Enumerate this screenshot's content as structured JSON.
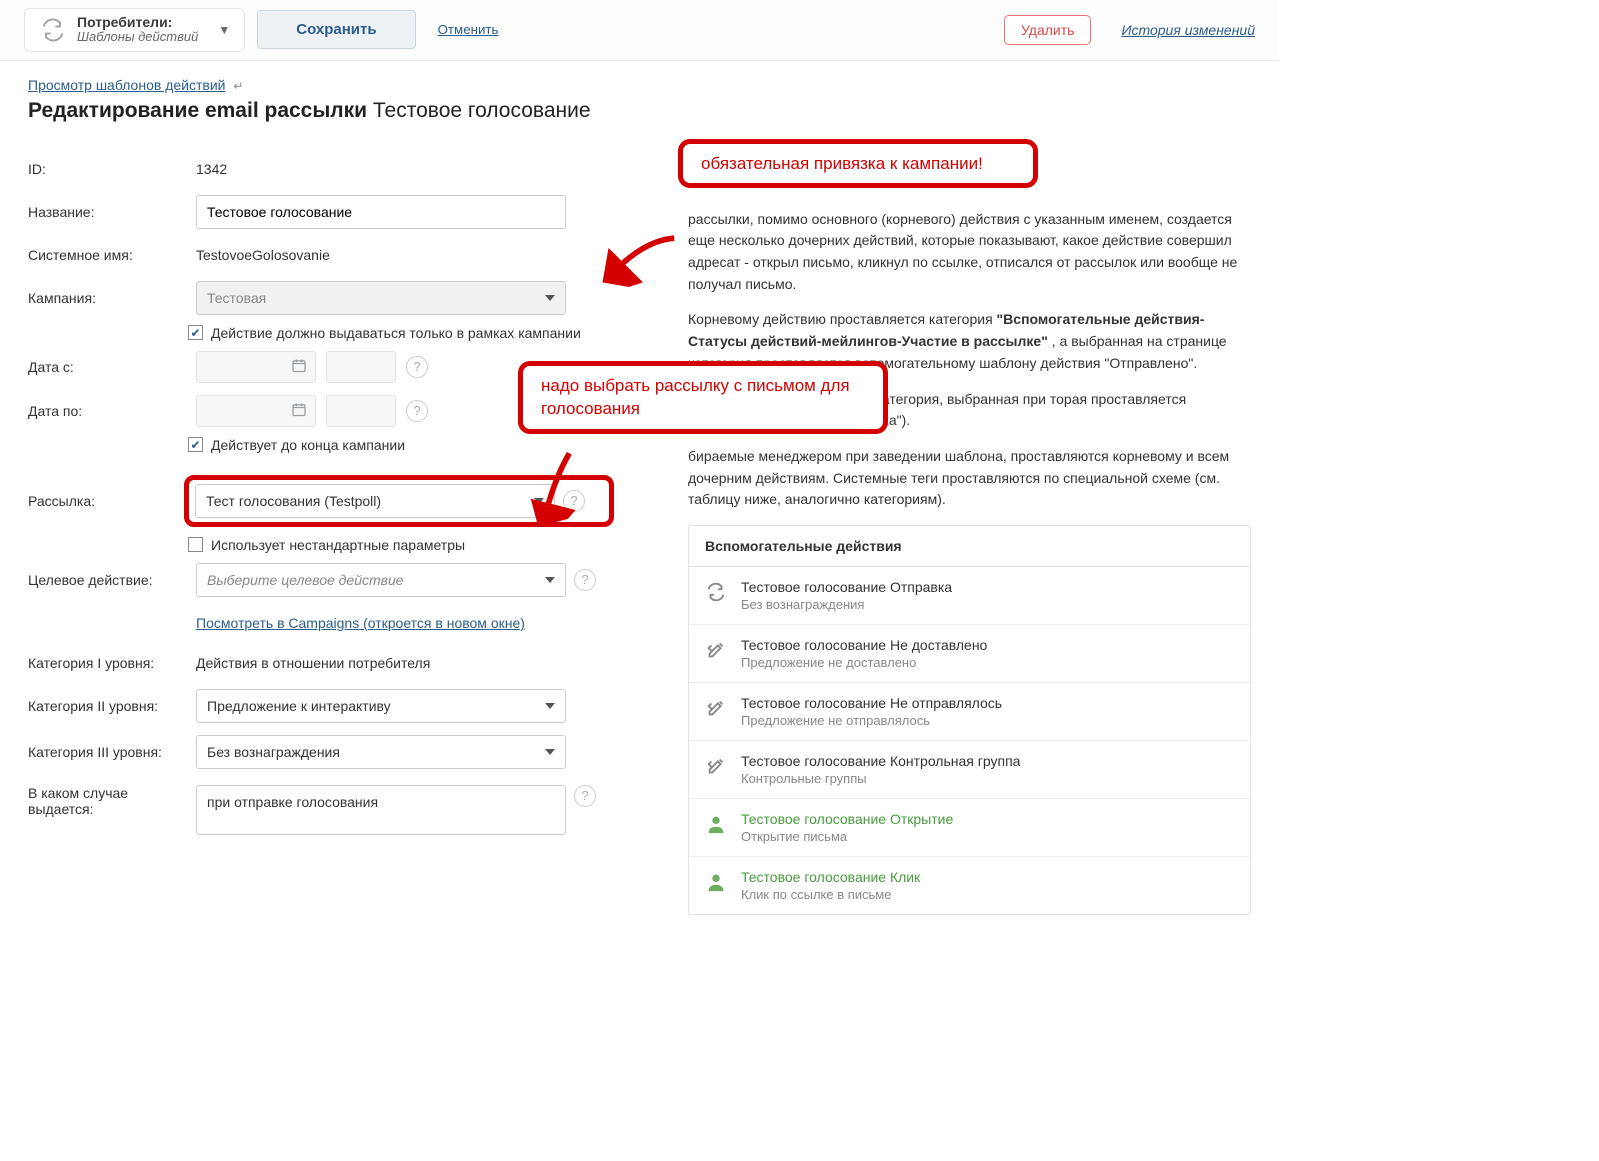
{
  "toolbar": {
    "context_line1": "Потребители:",
    "context_line2": "Шаблоны действий",
    "save": "Сохранить",
    "cancel": "Отменить",
    "delete": "Удалить",
    "history": "История изменений"
  },
  "breadcrumb": {
    "back": "Просмотр шаблонов действий"
  },
  "title": {
    "prefix": "Редактирование email рассылки",
    "name": "Тестовое голосование"
  },
  "form": {
    "id_label": "ID:",
    "id_value": "1342",
    "name_label": "Название:",
    "name_value": "Тестовое голосование",
    "sysname_label": "Системное имя:",
    "sysname_value": "TestovoeGolosovanie",
    "campaign_label": "Кампания:",
    "campaign_value": "Тестовая",
    "cb_campaign_only": "Действие должно выдаваться только в рамках кампании",
    "date_from_label": "Дата с:",
    "date_to_label": "Дата по:",
    "cb_till_end": "Действует до конца кампании",
    "mailing_label": "Рассылка:",
    "mailing_value": "Тест голосования (Testpoll)",
    "cb_nonstandard": "Использует нестандартные параметры",
    "target_label": "Целевое действие:",
    "target_placeholder": "Выберите целевое действие",
    "campaigns_link": "Посмотреть в Campaigns (откроется в новом окне)",
    "cat1_label": "Категория I уровня:",
    "cat1_value": "Действия в отношении потребителя",
    "cat2_label": "Категория II уровня:",
    "cat2_value": "Предложение к интерактиву",
    "cat3_label": "Категория III уровня:",
    "cat3_value": "Без вознаграждения",
    "when_label": "В каком случае выдается:",
    "when_value": "при отправке голосования"
  },
  "info": {
    "p1_start": "рассылки, помимо основного (корневого) действия с указанным именем, создается еще несколько дочерних действий, которые показывают, какое действие совершил адресат - открыл письмо, кликнул по ссылке, отписался от рассылок или вообще не получал письмо.",
    "p2_a": "Корневому действию проставляется категория ",
    "p2_b": "\"Вспомогательные действия-Статусы действий-мейлингов-Участие в рассылке\"",
    "p2_c": " , а выбранная на странице категория проставляется вспомогательному шаблону действия \"Отправлено\".",
    "p3": "блонов действий выводится категория, выбранная при торая проставляется дочернему действию \"Отправка\").",
    "p4": "бираемые менеджером при заведении шаблона, проставляются корневому и всем дочерним действиям. Системные теги проставляются по специальной схеме (см. таблицу ниже, аналогично категориям)."
  },
  "aux": {
    "header": "Вспомогательные действия",
    "items": [
      {
        "title": "Тестовое голосование Отправка",
        "sub": "Без вознаграждения",
        "kind": "refresh"
      },
      {
        "title": "Тестовое голосование Не доставлено",
        "sub": "Предложение не доставлено",
        "kind": "tools"
      },
      {
        "title": "Тестовое голосование Не отправлялось",
        "sub": "Предложение не отправлялось",
        "kind": "tools"
      },
      {
        "title": "Тестовое голосование Контрольная группа",
        "sub": "Контрольные группы",
        "kind": "tools"
      },
      {
        "title": "Тестовое голосование Открытие",
        "sub": "Открытие письма",
        "kind": "user"
      },
      {
        "title": "Тестовое голосование Клик",
        "sub": "Клик по ссылке в письме",
        "kind": "user"
      }
    ]
  },
  "callouts": {
    "c1": "обязательная привязка к кампании!",
    "c2": "надо выбрать рассылку с письмом для голосования"
  }
}
